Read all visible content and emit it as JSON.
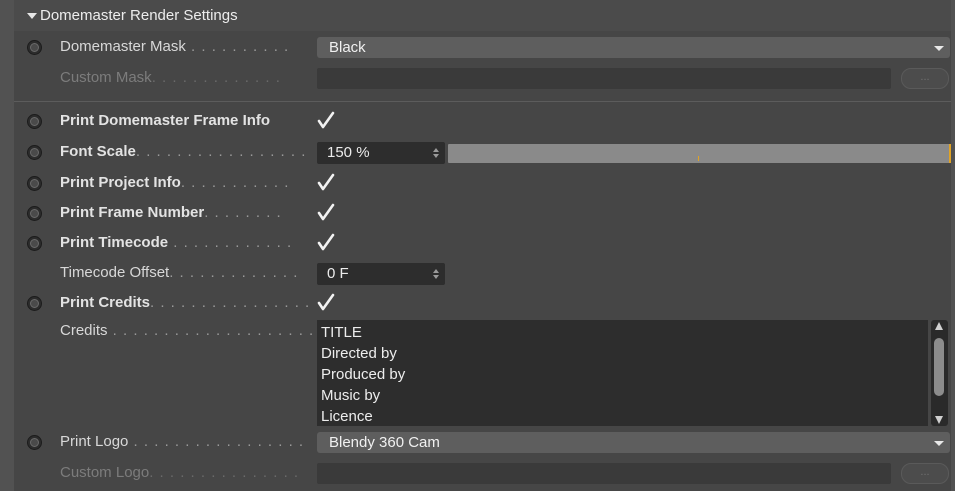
{
  "section": {
    "title": "Domemaster Render Settings"
  },
  "rows": {
    "mask": {
      "label": "Domemaster Mask",
      "dots": " . . . . . . . . . .",
      "value": "Black"
    },
    "custom_mask": {
      "label": "Custom Mask",
      "dots": ". . . . . . . . . . . . .",
      "button": "..."
    },
    "frame_info": {
      "label": "Print Domemaster Frame Info",
      "checked": true
    },
    "font_scale": {
      "label": "Font Scale",
      "dots": ". . . . . . . . . . . . . . . . .",
      "value": "150 %",
      "fraction": 1.0
    },
    "project_info": {
      "label": "Print Project Info",
      "dots": ". . . . . . . . . . .",
      "checked": true
    },
    "frame_number": {
      "label": "Print Frame Number",
      "dots": ". . . . . . . .",
      "checked": true
    },
    "timecode": {
      "label": "Print Timecode",
      "dots": " . . . . . . . . . . . .",
      "checked": true
    },
    "timecode_offset": {
      "label": "Timecode Offset",
      "dots": ". . . . . . . . . . . . .",
      "value": "0 F"
    },
    "credits_toggle": {
      "label": "Print Credits",
      "dots": ". . . . . . . . . . . . . . . .",
      "checked": true
    },
    "credits": {
      "label": "Credits",
      "dots": " . . . . . . . . . . . . . . . . . . . . . .",
      "lines": [
        "TITLE",
        "Directed by",
        "Produced by",
        "Music by",
        "Licence"
      ]
    },
    "logo": {
      "label": "Print Logo",
      "dots": " . . . . . . . . . . . . . . . . .",
      "value": "Blendy 360 Cam"
    },
    "custom_logo": {
      "label": "Custom Logo",
      "dots": ". . . . . . . . . . . . . . .",
      "button": "..."
    }
  },
  "colors": {
    "accent": "#e0a326",
    "panel": "#464646",
    "field": "#2d2d2d"
  }
}
